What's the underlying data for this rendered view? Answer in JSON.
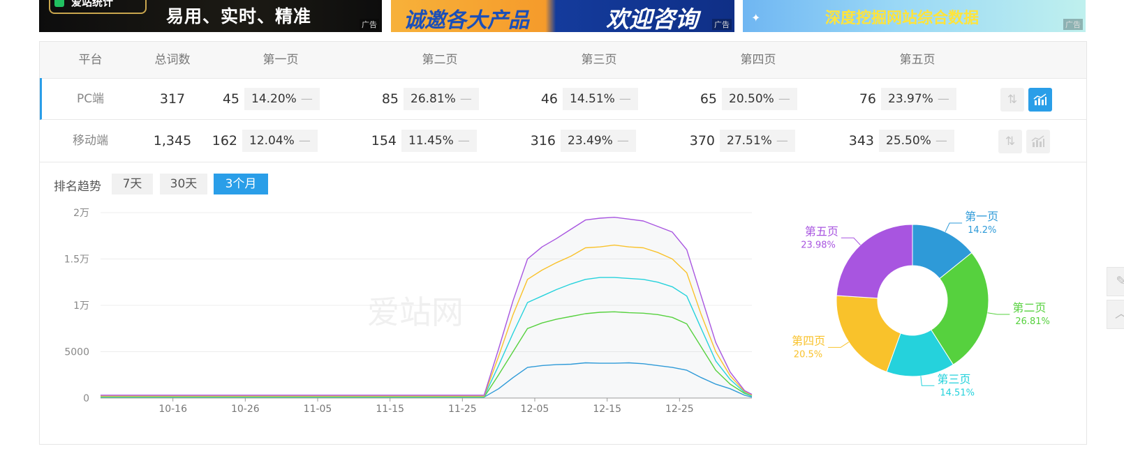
{
  "banners": [
    {
      "logo": "爱站统计",
      "text": "易用、实时、精准",
      "ad": "广告"
    },
    {
      "text_a": "诚邀各大产品",
      "text_b": "欢迎咨询",
      "ad": "广告"
    },
    {
      "text": "深度挖掘网站综合数据",
      "ad": "广告"
    }
  ],
  "table": {
    "headers": [
      "平台",
      "总词数",
      "第一页",
      "第二页",
      "第三页",
      "第四页",
      "第五页"
    ],
    "rows": [
      {
        "platform": "PC端",
        "total": "317",
        "pages": [
          {
            "count": "45",
            "pct": "14.20%"
          },
          {
            "count": "85",
            "pct": "26.81%"
          },
          {
            "count": "46",
            "pct": "14.51%"
          },
          {
            "count": "65",
            "pct": "20.50%"
          },
          {
            "count": "76",
            "pct": "23.97%"
          }
        ]
      },
      {
        "platform": "移动端",
        "total": "1,345",
        "pages": [
          {
            "count": "162",
            "pct": "12.04%"
          },
          {
            "count": "154",
            "pct": "11.45%"
          },
          {
            "count": "316",
            "pct": "23.49%"
          },
          {
            "count": "370",
            "pct": "27.51%"
          },
          {
            "count": "343",
            "pct": "25.50%"
          }
        ]
      }
    ],
    "icons": {
      "sort": "sort-icon",
      "chart": "trend-chart-icon"
    }
  },
  "trend": {
    "label": "排名趋势",
    "ranges": [
      "7天",
      "30天",
      "3个月"
    ],
    "active_range": "3个月"
  },
  "colors": {
    "accent": "#2a9ee8",
    "page1": "#2e9ad8",
    "page2": "#56d13e",
    "page3": "#25d2dc",
    "page4": "#f9c22b",
    "page5": "#a855e0"
  },
  "chart_data": [
    {
      "type": "line",
      "ylim": [
        0,
        20000
      ],
      "yticks": [
        0,
        5000,
        10000,
        15000,
        20000
      ],
      "ytick_labels": [
        "0",
        "5000",
        "1万",
        "1.5万",
        "2万"
      ],
      "xtick_labels": [
        "10-16",
        "10-26",
        "11-05",
        "11-15",
        "11-25",
        "12-05",
        "12-15",
        "12-25"
      ],
      "x": [
        "10-06",
        "10-16",
        "10-26",
        "11-05",
        "11-15",
        "11-25",
        "11-28",
        "11-30",
        "12-02",
        "12-04",
        "12-06",
        "12-08",
        "12-10",
        "12-12",
        "12-14",
        "12-16",
        "12-18",
        "12-20",
        "12-22",
        "12-24",
        "12-26",
        "12-28",
        "12-30",
        "01-01",
        "01-03",
        "01-04"
      ],
      "grid": true,
      "watermark": "爱站网",
      "series": [
        {
          "color": "#2e9ad8",
          "values": [
            100,
            100,
            100,
            100,
            100,
            100,
            100,
            1000,
            2200,
            3300,
            3500,
            3600,
            3650,
            3800,
            3750,
            3750,
            3800,
            3700,
            3500,
            3300,
            3000,
            2200,
            1500,
            1000,
            300,
            100
          ]
        },
        {
          "color": "#56d13e",
          "values": [
            100,
            100,
            100,
            100,
            100,
            100,
            100,
            2500,
            5000,
            7500,
            8100,
            8500,
            8800,
            9100,
            9250,
            9300,
            9200,
            9150,
            9000,
            8700,
            8000,
            5500,
            3000,
            1500,
            500,
            200
          ]
        },
        {
          "color": "#25d2dc",
          "values": [
            150,
            150,
            150,
            150,
            150,
            150,
            150,
            3500,
            7000,
            10300,
            11000,
            11700,
            12300,
            12800,
            13000,
            13000,
            12900,
            12800,
            12500,
            12000,
            11000,
            7500,
            4000,
            2000,
            600,
            200
          ]
        },
        {
          "color": "#f9c22b",
          "values": [
            200,
            200,
            200,
            200,
            200,
            200,
            200,
            4500,
            9000,
            12800,
            13800,
            14600,
            15300,
            16200,
            16300,
            16500,
            16300,
            16200,
            15700,
            15000,
            13500,
            9000,
            5000,
            2400,
            700,
            300
          ]
        },
        {
          "color": "#a855e0",
          "values": [
            300,
            300,
            300,
            300,
            300,
            300,
            300,
            5300,
            10500,
            15000,
            16300,
            17200,
            18200,
            19200,
            19400,
            19500,
            19300,
            19100,
            18500,
            17900,
            16000,
            11000,
            6000,
            2800,
            800,
            400
          ]
        }
      ]
    },
    {
      "type": "pie",
      "donut": true,
      "slices": [
        {
          "label": "第一页",
          "value": 14.2,
          "value_label": "14.2%",
          "color": "#2e9ad8"
        },
        {
          "label": "第二页",
          "value": 26.81,
          "value_label": "26.81%",
          "color": "#56d13e"
        },
        {
          "label": "第三页",
          "value": 14.51,
          "value_label": "14.51%",
          "color": "#25d2dc"
        },
        {
          "label": "第四页",
          "value": 20.5,
          "value_label": "20.5%",
          "color": "#f9c22b"
        },
        {
          "label": "第五页",
          "value": 23.98,
          "value_label": "23.98%",
          "color": "#a855e0"
        }
      ]
    }
  ]
}
